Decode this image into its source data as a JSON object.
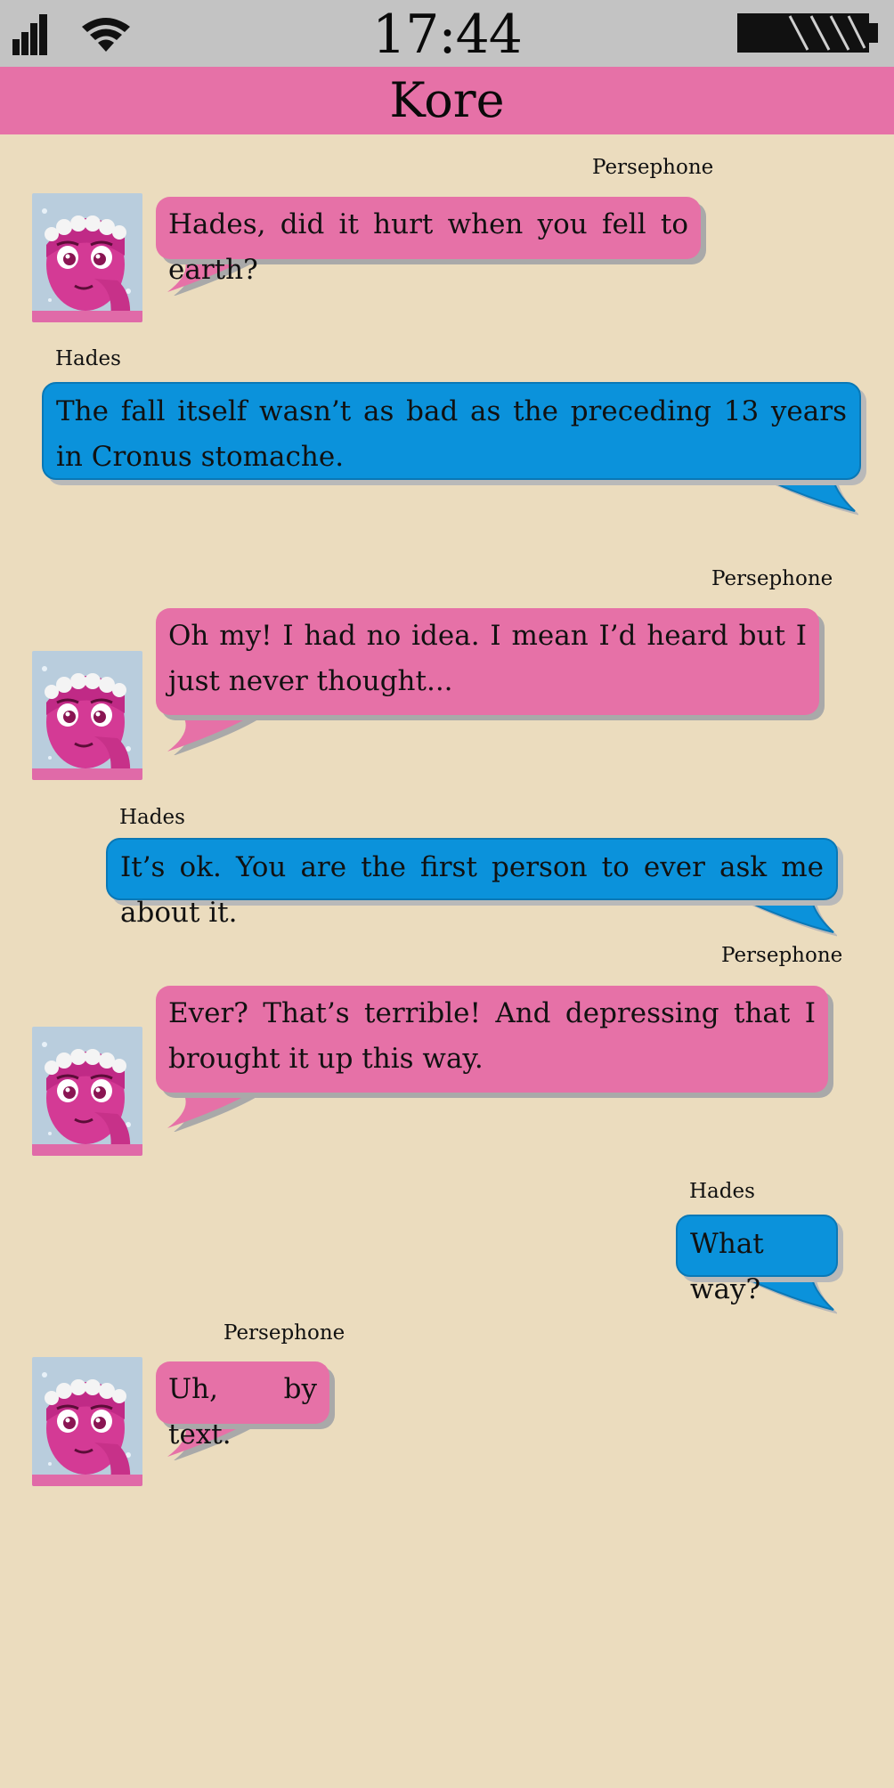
{
  "status_bar": {
    "time": "17:44",
    "icons": [
      "signal-icon",
      "wifi-icon",
      "battery-icon"
    ]
  },
  "header": {
    "title": "Kore"
  },
  "colors": {
    "persephone_bubble": "#e671a7",
    "hades_bubble": "#0b92db",
    "background": "#ebdcbe",
    "status_bar": "#c3c3c3"
  },
  "messages": [
    {
      "sender": "Persephone",
      "text": "Hades, did it hurt when you fell to earth?"
    },
    {
      "sender": "Hades",
      "text": "The fall itself wasn’t as bad as the preceding 13 years in Cronus stomache."
    },
    {
      "sender": "Persephone",
      "text": "Oh my! I had no idea. I mean I’d heard but I just never thought..."
    },
    {
      "sender": "Hades",
      "text": "It’s ok. You are the first person to ever ask me about it."
    },
    {
      "sender": "Persephone",
      "text": "Ever? That’s terrible! And depressing that I brought it up this way."
    },
    {
      "sender": "Hades",
      "text": "What way?"
    },
    {
      "sender": "Persephone",
      "text": "Uh, by text."
    }
  ]
}
